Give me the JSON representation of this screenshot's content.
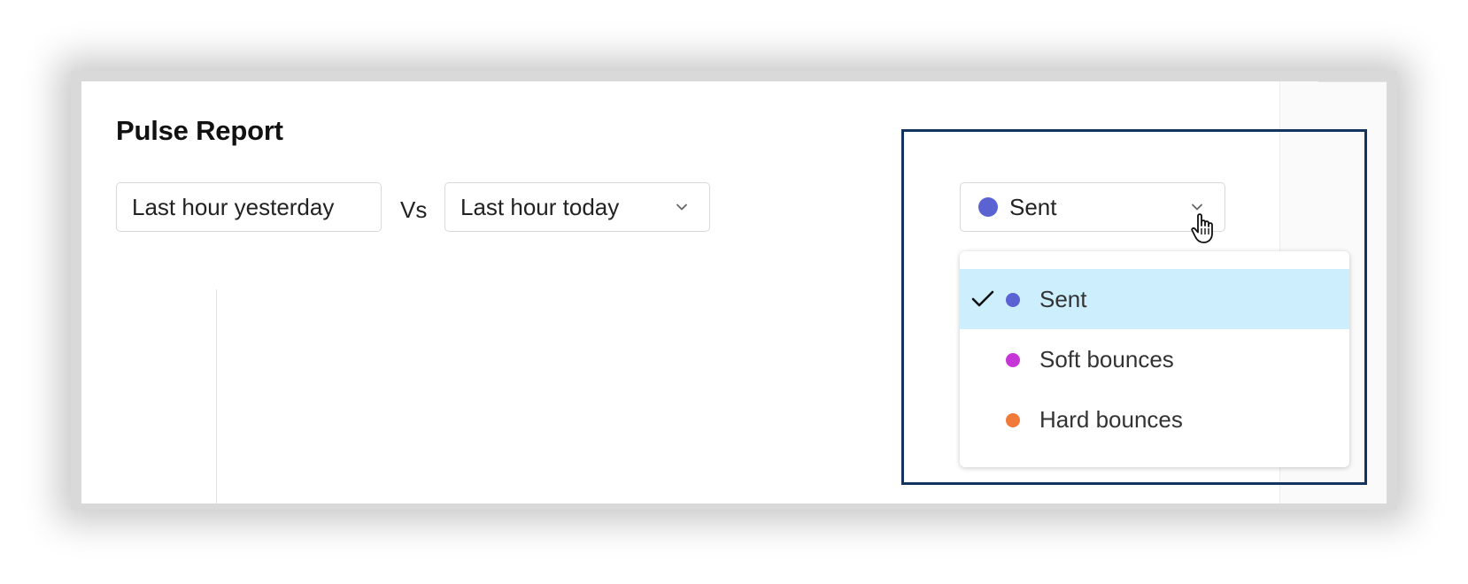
{
  "report": {
    "title": "Pulse Report"
  },
  "comparison": {
    "left_period": "Last hour yesterday",
    "separator": "Vs",
    "right_period": "Last hour today"
  },
  "metric_select": {
    "selected_label": "Sent",
    "selected_color": "#5b63d3",
    "options": [
      {
        "label": "Sent",
        "color": "#5b63d3",
        "selected": true
      },
      {
        "label": "Soft bounces",
        "color": "#c635d6",
        "selected": false
      },
      {
        "label": "Hard bounces",
        "color": "#f07a3a",
        "selected": false
      }
    ]
  },
  "colors": {
    "highlight_border": "#14335e",
    "selected_row": "#cdeefc"
  },
  "icons": {
    "dropdown": "chevron-down-icon",
    "check": "checkmark-icon",
    "pointer": "hand-cursor-icon"
  }
}
